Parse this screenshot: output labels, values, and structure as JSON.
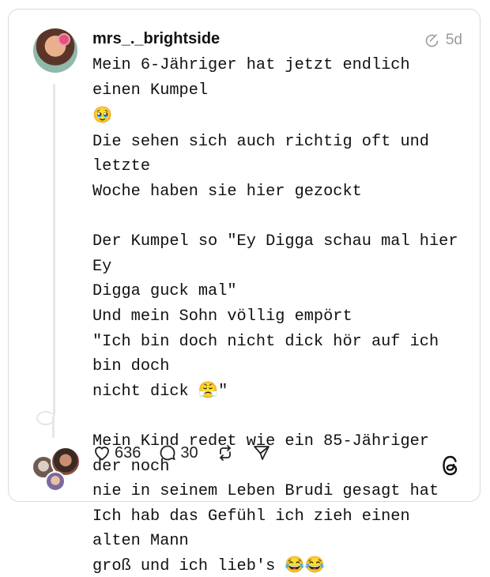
{
  "post": {
    "username": "mrs_._brightside",
    "time": "5d",
    "lines": [
      "Mein 6-Jähriger hat jetzt endlich einen Kumpel",
      "🥹",
      "Die sehen sich auch richtig oft und letzte",
      "Woche haben sie hier gezockt",
      "",
      "Der Kumpel so \"Ey Digga schau mal hier Ey",
      "Digga guck mal\"",
      "Und mein Sohn völlig empört",
      "\"Ich bin doch nicht dick hör auf ich bin doch",
      "nicht dick 😤\"",
      "",
      "Mein Kind redet wie ein 85-Jähriger der noch",
      "nie in seinem Leben Brudi gesagt hat",
      "Ich hab das Gefühl ich zieh einen alten Mann",
      "groß und ich lieb's 😂😂"
    ]
  },
  "actions": {
    "likes": "636",
    "replies": "30"
  },
  "icons": {
    "time": "edited-clock-icon",
    "like": "heart-icon",
    "reply": "comment-icon",
    "repost": "repost-icon",
    "share": "send-icon",
    "brand": "threads-logo"
  }
}
